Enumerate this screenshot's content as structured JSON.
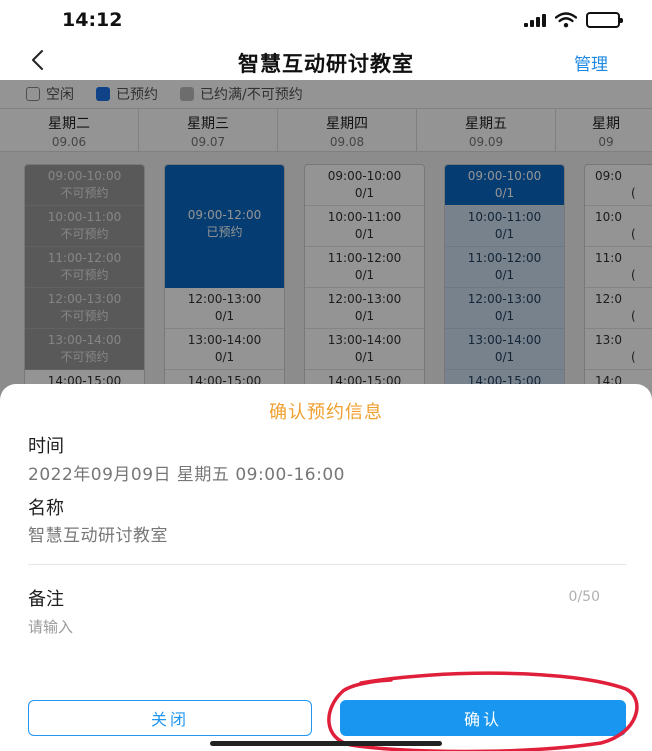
{
  "status_bar": {
    "time": "14:12"
  },
  "nav": {
    "title": "智慧互动研讨教室",
    "manage_label": "管理"
  },
  "legend": [
    {
      "label": "空闲",
      "swatch": "free"
    },
    {
      "label": "已预约",
      "swatch": "booked"
    },
    {
      "label": "已约满/不可预约",
      "swatch": "full"
    }
  ],
  "days": [
    {
      "weekday": "星期二",
      "date": "09.06"
    },
    {
      "weekday": "星期三",
      "date": "09.07"
    },
    {
      "weekday": "星期四",
      "date": "09.08"
    },
    {
      "weekday": "星期五",
      "date": "09.09"
    },
    {
      "weekday": "星期",
      "date": "09"
    }
  ],
  "schedule": {
    "tuesday": [
      {
        "time": "09:00-10:00",
        "status": "不可预约"
      },
      {
        "time": "10:00-11:00",
        "status": "不可预约"
      },
      {
        "time": "11:00-12:00",
        "status": "不可预约"
      },
      {
        "time": "12:00-13:00",
        "status": "不可预约"
      },
      {
        "time": "13:00-14:00",
        "status": "不可预约"
      },
      {
        "time": "14:00-15:00",
        "status": ""
      }
    ],
    "wednesday": {
      "booked": {
        "time": "09:00-12:00",
        "status": "已预约"
      },
      "slots": [
        {
          "time": "12:00-13:00",
          "status": "0/1"
        },
        {
          "time": "13:00-14:00",
          "status": "0/1"
        },
        {
          "time": "14:00-15:00",
          "status": ""
        }
      ]
    },
    "thursday": [
      {
        "time": "09:00-10:00",
        "status": "0/1"
      },
      {
        "time": "10:00-11:00",
        "status": "0/1"
      },
      {
        "time": "11:00-12:00",
        "status": "0/1"
      },
      {
        "time": "12:00-13:00",
        "status": "0/1"
      },
      {
        "time": "13:00-14:00",
        "status": "0/1"
      },
      {
        "time": "14:00-15:00",
        "status": ""
      }
    ],
    "friday": [
      {
        "time": "09:00-10:00",
        "status": "0/1"
      },
      {
        "time": "10:00-11:00",
        "status": "0/1"
      },
      {
        "time": "11:00-12:00",
        "status": "0/1"
      },
      {
        "time": "12:00-13:00",
        "status": "0/1"
      },
      {
        "time": "13:00-14:00",
        "status": "0/1"
      },
      {
        "time": "14:00-15:00",
        "status": ""
      }
    ],
    "partial": [
      {
        "time": "09:0",
        "status": "("
      },
      {
        "time": "10:0",
        "status": "("
      },
      {
        "time": "11:0",
        "status": "("
      },
      {
        "time": "12:0",
        "status": "("
      },
      {
        "time": "13:0",
        "status": "("
      },
      {
        "time": "14:0",
        "status": ""
      }
    ]
  },
  "sheet": {
    "title": "确认预约信息",
    "time_label": "时间",
    "time_value": "2022年09月09日 星期五 09:00-16:00",
    "name_label": "名称",
    "name_value": "智慧互动研讨教室",
    "remark_label": "备注",
    "remark_counter": "0/50",
    "remark_placeholder": "请输入",
    "close_label": "关闭",
    "confirm_label": "确认"
  },
  "colors": {
    "accent": "#1896f0",
    "title_orange": "#f0a030",
    "annotation_red": "#e0203a"
  }
}
